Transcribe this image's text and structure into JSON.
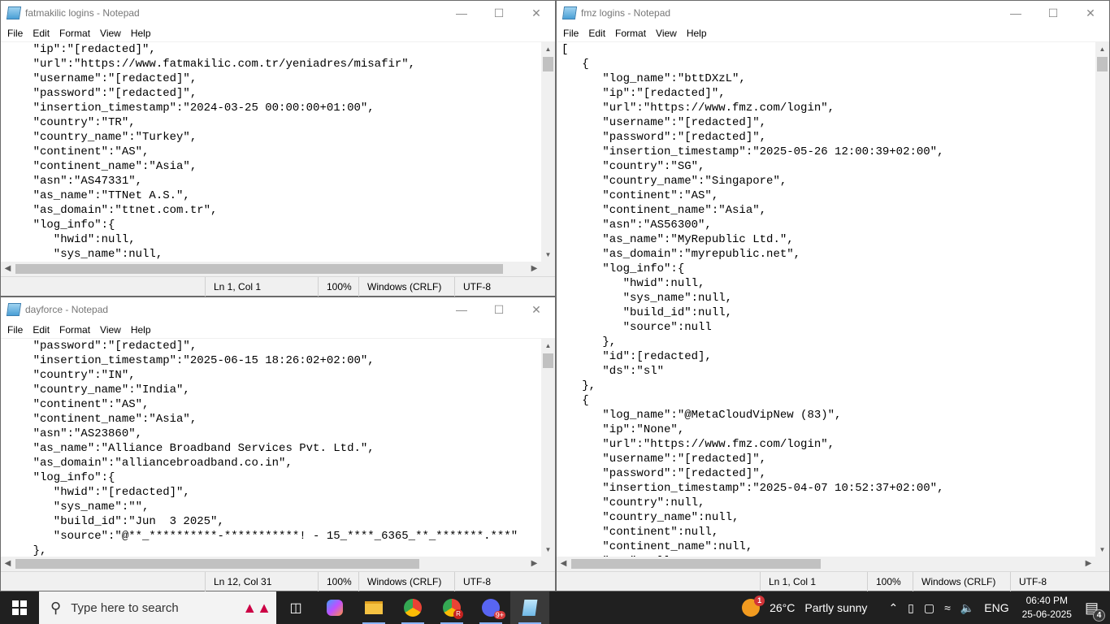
{
  "windows": {
    "left_top": {
      "title": "fatmakilic logins - Notepad",
      "menu": [
        "File",
        "Edit",
        "Format",
        "View",
        "Help"
      ],
      "lines": [
        "    \"ip\":\"[redacted]\",",
        "    \"url\":\"https://www.fatmakilic.com.tr/yeniadres/misafir\",",
        "    \"username\":\"[redacted]\",",
        "    \"password\":\"[redacted]\",",
        "    \"insertion_timestamp\":\"2024-03-25 00:00:00+01:00\",",
        "    \"country\":\"TR\",",
        "    \"country_name\":\"Turkey\",",
        "    \"continent\":\"AS\",",
        "    \"continent_name\":\"Asia\",",
        "    \"asn\":\"AS47331\",",
        "    \"as_name\":\"TTNet A.S.\",",
        "    \"as_domain\":\"ttnet.com.tr\",",
        "    \"log_info\":{",
        "       \"hwid\":null,",
        "       \"sys_name\":null,"
      ],
      "status": {
        "position": "Ln 1, Col 1",
        "zoom": "100%",
        "line_ending": "Windows (CRLF)",
        "encoding": "UTF-8"
      }
    },
    "left_bottom": {
      "title": "dayforce - Notepad",
      "menu": [
        "File",
        "Edit",
        "Format",
        "View",
        "Help"
      ],
      "lines": [
        "    \"password\":\"[redacted]\",",
        "    \"insertion_timestamp\":\"2025-06-15 18:26:02+02:00\",",
        "    \"country\":\"IN\",",
        "    \"country_name\":\"India\",",
        "    \"continent\":\"AS\",",
        "    \"continent_name\":\"Asia\",",
        "    \"asn\":\"AS23860\",",
        "    \"as_name\":\"Alliance Broadband Services Pvt. Ltd.\",",
        "    \"as_domain\":\"alliancebroadband.co.in\",",
        "    \"log_info\":{",
        "       \"hwid\":\"[redacted]\",",
        "       \"sys_name\":\"\",",
        "       \"build_id\":\"Jun  3 2025\",",
        "       \"source\":\"@**_**********-***********! - 15_****_6365_**_*******.***\"",
        "    },"
      ],
      "status": {
        "position": "Ln 12, Col 31",
        "zoom": "100%",
        "line_ending": "Windows (CRLF)",
        "encoding": "UTF-8"
      }
    },
    "right": {
      "title": "fmz logins - Notepad",
      "menu": [
        "File",
        "Edit",
        "Format",
        "View",
        "Help"
      ],
      "lines": [
        "[",
        "   {",
        "      \"log_name\":\"bttDXzL\",",
        "      \"ip\":\"[redacted]\",",
        "      \"url\":\"https://www.fmz.com/login\",",
        "      \"username\":\"[redacted]\",",
        "      \"password\":\"[redacted]\",",
        "      \"insertion_timestamp\":\"2025-05-26 12:00:39+02:00\",",
        "      \"country\":\"SG\",",
        "      \"country_name\":\"Singapore\",",
        "      \"continent\":\"AS\",",
        "      \"continent_name\":\"Asia\",",
        "      \"asn\":\"AS56300\",",
        "      \"as_name\":\"MyRepublic Ltd.\",",
        "      \"as_domain\":\"myrepublic.net\",",
        "      \"log_info\":{",
        "         \"hwid\":null,",
        "         \"sys_name\":null,",
        "         \"build_id\":null,",
        "         \"source\":null",
        "      },",
        "      \"id\":[redacted],",
        "      \"ds\":\"sl\"",
        "   },",
        "   {",
        "      \"log_name\":\"@MetaCloudVipNew (83)\",",
        "      \"ip\":\"None\",",
        "      \"url\":\"https://www.fmz.com/login\",",
        "      \"username\":\"[redacted]\",",
        "      \"password\":\"[redacted]\",",
        "      \"insertion_timestamp\":\"2025-04-07 10:52:37+02:00\",",
        "      \"country\":null,",
        "      \"country_name\":null,",
        "      \"continent\":null,",
        "      \"continent_name\":null,",
        "      \"asn\":null,"
      ],
      "status": {
        "position": "Ln 1, Col 1",
        "zoom": "100%",
        "line_ending": "Windows (CRLF)",
        "encoding": "UTF-8"
      }
    }
  },
  "taskbar": {
    "search_placeholder": "Type here to search",
    "weather_temp": "26°C",
    "weather_text": "Partly sunny",
    "weather_badge": "1",
    "language": "ENG",
    "time": "06:40 PM",
    "date": "25-06-2025",
    "notification_count": "4",
    "app_badges": {
      "chrome_profile": "R",
      "discord": "9+"
    }
  }
}
